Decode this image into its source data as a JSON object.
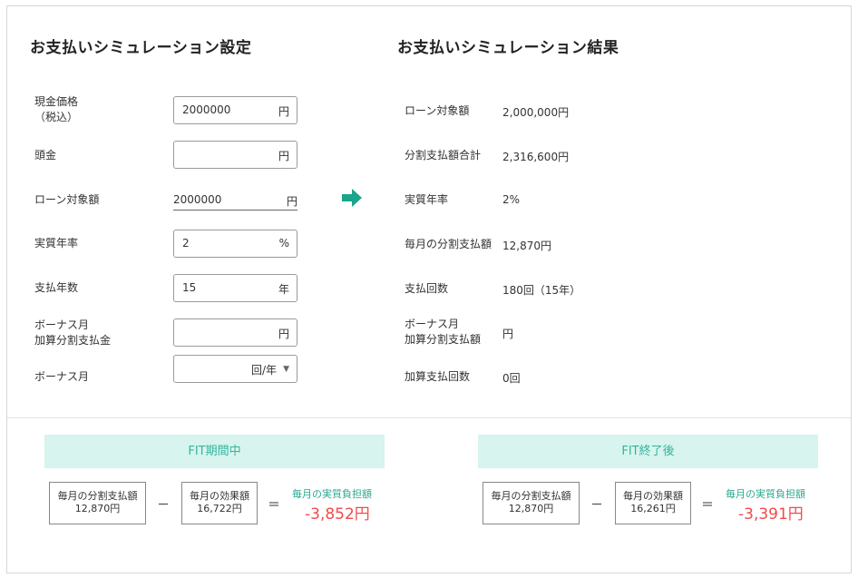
{
  "settings": {
    "title": "お支払いシミュレーション設定",
    "cash_price": {
      "label_line1": "現金価格",
      "label_line2": "（税込）",
      "value": "2000000",
      "unit": "円"
    },
    "down_payment": {
      "label": "頭金",
      "value": "",
      "unit": "円"
    },
    "loan_amount": {
      "label": "ローン対象額",
      "value": "2000000",
      "unit": "円"
    },
    "annual_rate": {
      "label": "実質年率",
      "value": "2",
      "unit": "%"
    },
    "years": {
      "label": "支払年数",
      "value": "15",
      "unit": "年"
    },
    "bonus_add": {
      "label_line1": "ボーナス月",
      "label_line2": "加算分割支払金",
      "value": "",
      "unit": "円"
    },
    "bonus_month": {
      "label": "ボーナス月",
      "value": "",
      "unit": "回/年"
    }
  },
  "results": {
    "title": "お支払いシミュレーション結果",
    "rows": [
      {
        "label": "ローン対象額",
        "value": "2,000,000円"
      },
      {
        "label": "分割支払額合計",
        "value": "2,316,600円"
      },
      {
        "label": "実質年率",
        "value": "2%"
      },
      {
        "label": "毎月の分割支払額",
        "value": "12,870円"
      },
      {
        "label": "支払回数",
        "value": "180回（15年）"
      },
      {
        "label_line1": "ボーナス月",
        "label_line2": "加算分割支払額",
        "value": "円"
      },
      {
        "label": "加算支払回数",
        "value": "0回"
      }
    ]
  },
  "fit_during": {
    "title": "FIT期間中",
    "installment_label": "毎月の分割支払額",
    "installment_value": "12,870円",
    "effect_label": "毎月の効果額",
    "effect_value": "16,722円",
    "burden_label": "毎月の実質負担額",
    "burden_value": "-3,852円"
  },
  "fit_after": {
    "title": "FIT終了後",
    "installment_label": "毎月の分割支払額",
    "installment_value": "12,870円",
    "effect_label": "毎月の効果額",
    "effect_value": "16,261円",
    "burden_label": "毎月の実質負担額",
    "burden_value": "-3,391円"
  },
  "operators": {
    "minus": "－",
    "equals": "＝"
  },
  "colors": {
    "accent": "#2aa890",
    "banner_bg": "#d7f4ee",
    "negative": "#f24a4a"
  }
}
